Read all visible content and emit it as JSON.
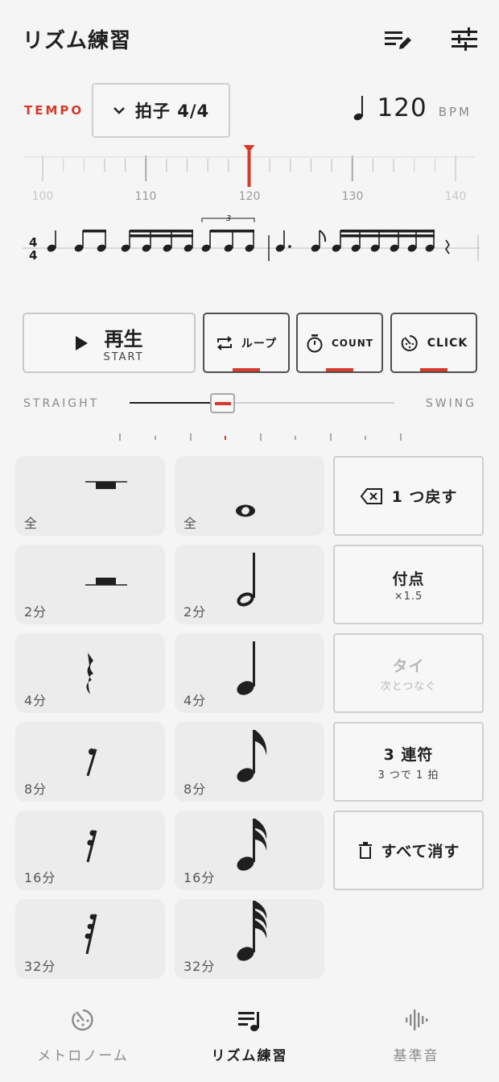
{
  "header": {
    "title": "リズム練習",
    "icons": [
      "edit-list-icon",
      "sliders-icon"
    ]
  },
  "tempo": {
    "label": "TEMPO",
    "meter": "拍子 4/4",
    "bpm": "120",
    "bpm_unit": "BPM",
    "ruler_labels": [
      "100",
      "110",
      "120",
      "130",
      "140"
    ],
    "current_bpm": 120,
    "accent_color": "#d8392b"
  },
  "notation": {
    "time_signature_top": "4",
    "time_signature_bottom": "4",
    "tuplet_label": "3"
  },
  "transport": {
    "play_main": "再生",
    "play_sub": "START",
    "loop_label": "ループ",
    "count_label": "COUNT",
    "click_label": "CLICK"
  },
  "swing": {
    "left_label": "STRAIGHT",
    "right_label": "SWING",
    "value": 0.25
  },
  "palette": {
    "rests": [
      {
        "label": "全",
        "icon": "whole-rest-icon"
      },
      {
        "label": "2分",
        "icon": "half-rest-icon"
      },
      {
        "label": "4分",
        "icon": "quarter-rest-icon"
      },
      {
        "label": "8分",
        "icon": "eighth-rest-icon"
      },
      {
        "label": "16分",
        "icon": "sixteenth-rest-icon"
      },
      {
        "label": "32分",
        "icon": "thirty-second-rest-icon"
      }
    ],
    "notes": [
      {
        "label": "全",
        "icon": "whole-note-icon"
      },
      {
        "label": "2分",
        "icon": "half-note-icon"
      },
      {
        "label": "4分",
        "icon": "quarter-note-icon"
      },
      {
        "label": "8分",
        "icon": "eighth-note-icon"
      },
      {
        "label": "16分",
        "icon": "sixteenth-note-icon"
      },
      {
        "label": "32分",
        "icon": "thirty-second-note-icon"
      }
    ],
    "actions": {
      "undo": "1 つ戻す",
      "dot_main": "付点",
      "dot_sub": "×1.5",
      "tie_main": "タイ",
      "tie_sub": "次とつなぐ",
      "triplet_main": "3 連符",
      "triplet_sub": "3 つで 1 拍",
      "clear": "すべて消す"
    }
  },
  "nav": [
    {
      "label": "メトロノーム",
      "icon": "metronome-icon",
      "active": false
    },
    {
      "label": "リズム練習",
      "icon": "rhythm-list-icon",
      "active": true
    },
    {
      "label": "基準音",
      "icon": "waveform-icon",
      "active": false
    }
  ]
}
